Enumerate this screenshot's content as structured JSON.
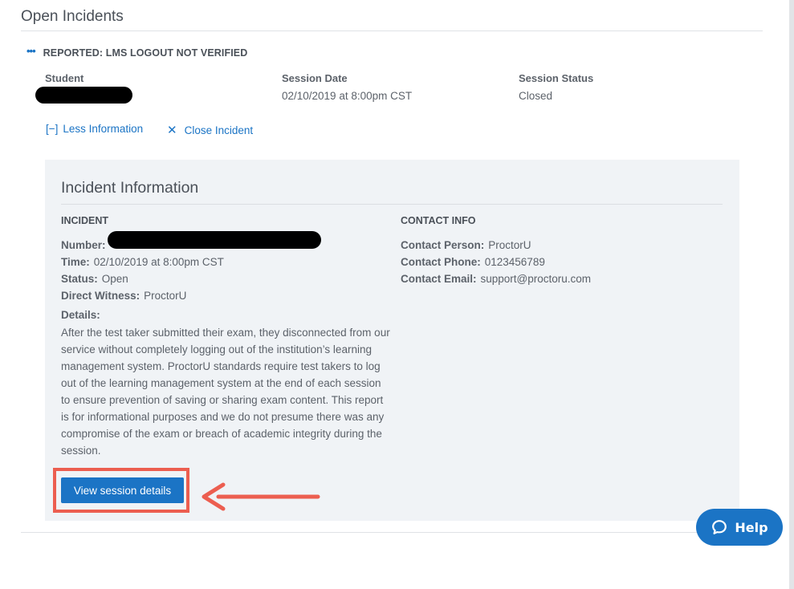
{
  "page": {
    "title": "Open Incidents"
  },
  "incident": {
    "type_label": "REPORTED: LMS LOGOUT NOT VERIFIED",
    "summary": {
      "student_label": "Student",
      "session_date_label": "Session Date",
      "session_date_value": "02/10/2019 at 8:00pm CST",
      "session_status_label": "Session Status",
      "session_status_value": "Closed"
    },
    "links": {
      "less_info_icon": "[−]",
      "less_info_label": "Less Information",
      "close_icon": "✕",
      "close_label": "Close Incident"
    }
  },
  "panel": {
    "title": "Incident Information",
    "incident_section": {
      "heading": "INCIDENT",
      "number_label": "Number:",
      "time_label": "Time:",
      "time_value": "02/10/2019 at 8:00pm CST",
      "status_label": "Status:",
      "status_value": "Open",
      "witness_label": "Direct Witness:",
      "witness_value": "ProctorU",
      "details_label": "Details:",
      "details_text": "After the test taker submitted their exam, they disconnected from our service without completely logging out of the institution’s learning management system. ProctorU standards require test takers to log out of the learning management system at the end of each session to ensure prevention of saving or sharing exam content. This report is for informational purposes and we do not presume there was any compromise of the exam or breach of academic integrity during the session."
    },
    "contact_section": {
      "heading": "CONTACT INFO",
      "person_label": "Contact Person:",
      "person_value": "ProctorU",
      "phone_label": "Contact Phone:",
      "phone_value": "0123456789",
      "email_label": "Contact Email:",
      "email_value": "support@proctoru.com"
    },
    "view_button_label": "View session details"
  },
  "help": {
    "label": "Help",
    "icon": "chat-bubble-icon"
  },
  "colors": {
    "accent": "#1b74c5",
    "annotation_red": "#ec5e50",
    "panel_bg": "#f0f3f6"
  }
}
